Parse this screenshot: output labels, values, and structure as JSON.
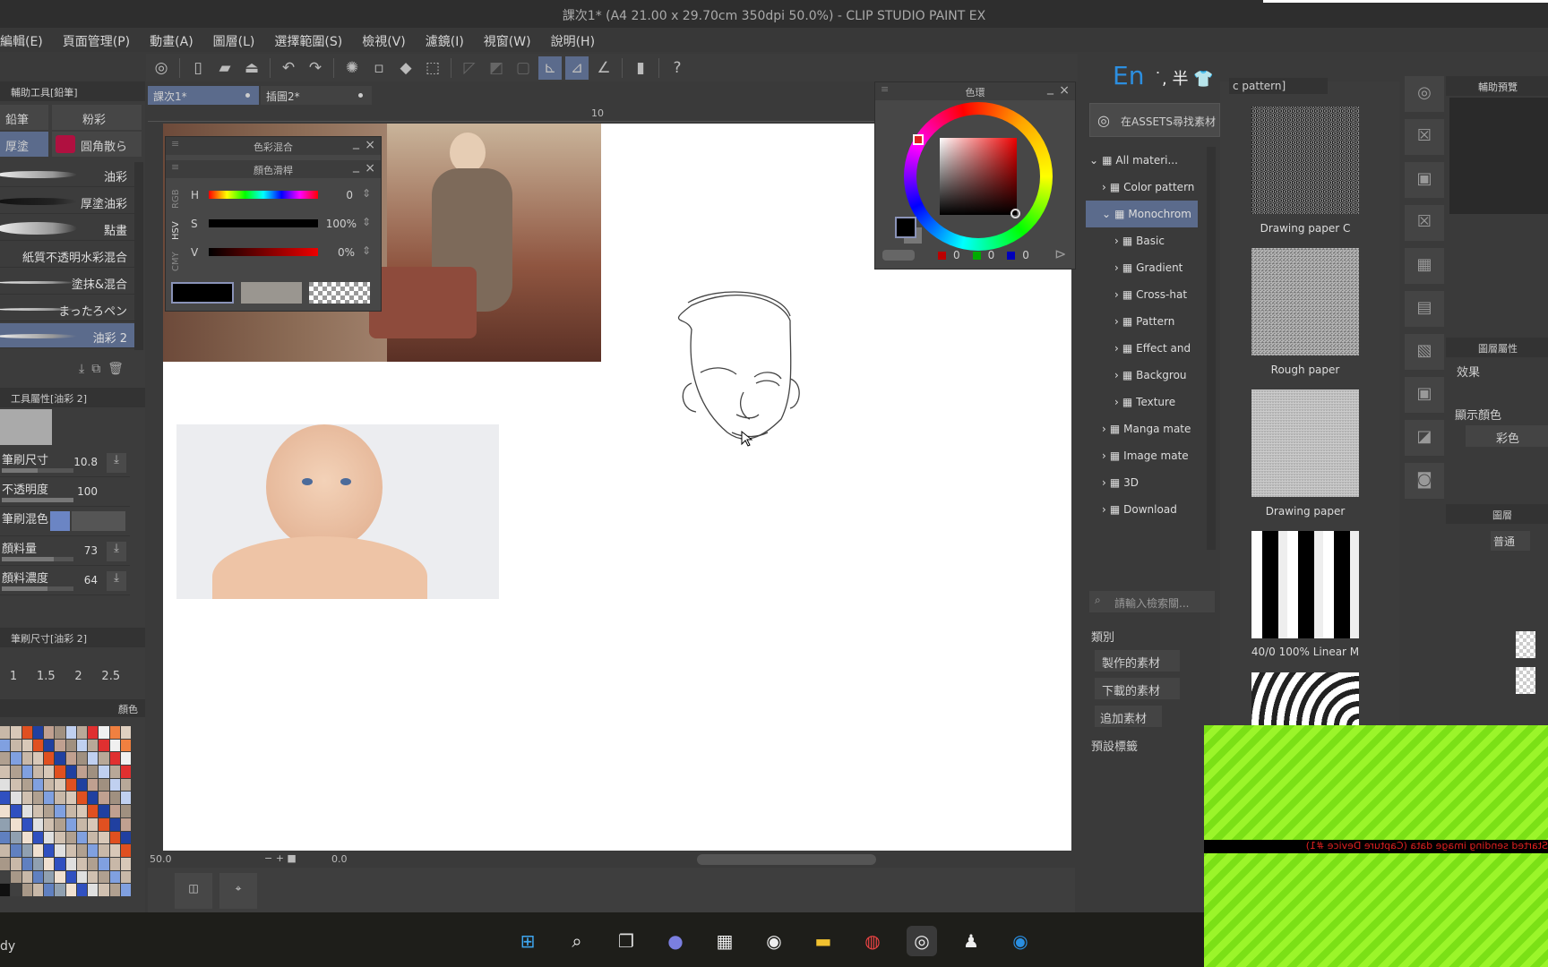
{
  "title": "課次1* (A4 21.00 x 29.70cm 350dpi 50.0%) - CLIP STUDIO PAINT EX",
  "menu": [
    "編輯(E)",
    "頁面管理(P)",
    "動畫(A)",
    "圖層(L)",
    "選擇範圍(S)",
    "檢視(V)",
    "濾鏡(I)",
    "視窗(W)",
    "說明(H)"
  ],
  "doc_tabs": [
    "課次1*",
    "插圖2*"
  ],
  "ruler_label": "10",
  "left": {
    "subtool_header": "輔助工具[鉛筆]",
    "subtabs": [
      "鉛筆",
      "粉彩",
      "厚塗",
      "圓角散ら"
    ],
    "brushes": [
      "油彩",
      "厚塗油彩",
      "點畫",
      "紙質不透明水彩混合",
      "塗抹&混合",
      "まったろペン",
      "油彩 2"
    ],
    "selected_brush": "油彩 2",
    "tool_prop_header": "工具屬性[油彩 2]",
    "props": [
      {
        "label": "筆刷尺寸",
        "value": "10.8",
        "level": 0.5
      },
      {
        "label": "不透明度",
        "value": "100",
        "level": 1.0
      },
      {
        "label": "筆刷混色",
        "value": "",
        "level": 0
      },
      {
        "label": "顏料量",
        "value": "73",
        "level": 0.73
      },
      {
        "label": "顏料濃度",
        "value": "64",
        "level": 0.64
      }
    ],
    "brush_size_header": "筆刷尺寸[油彩 2]",
    "sizes": [
      "1",
      "1.5",
      "2",
      "2.5"
    ],
    "color_set_label": "顏色"
  },
  "mix": {
    "outer_title": "色彩混合",
    "title": "顏色滑桿",
    "modes": [
      "RGB",
      "HSV",
      "CMY"
    ],
    "active_mode": "HSV",
    "sliders": [
      {
        "label": "H",
        "value": "0"
      },
      {
        "label": "S",
        "value": "100%"
      },
      {
        "label": "V",
        "value": "0%"
      }
    ],
    "main_color": "#000000",
    "sub_color": "#9a9690"
  },
  "color_wheel": {
    "title": "色環",
    "r": "0",
    "g": "0",
    "b": "0",
    "hue_color": "#ff0000"
  },
  "materials": {
    "lang": "En",
    "path_label": "c pattern]",
    "assets_button": "在ASSETS尋找素材",
    "tree": [
      {
        "label": "All materi...",
        "indent": 0,
        "open": true
      },
      {
        "label": "Color pattern",
        "indent": 1
      },
      {
        "label": "Monochrom",
        "indent": 1,
        "open": true,
        "selected": true
      },
      {
        "label": "Basic",
        "indent": 2
      },
      {
        "label": "Gradient",
        "indent": 2
      },
      {
        "label": "Cross-hat",
        "indent": 2
      },
      {
        "label": "Pattern",
        "indent": 2
      },
      {
        "label": "Effect and",
        "indent": 2
      },
      {
        "label": "Backgrou",
        "indent": 2
      },
      {
        "label": "Texture",
        "indent": 2
      },
      {
        "label": "Manga mate",
        "indent": 1
      },
      {
        "label": "Image mate",
        "indent": 1
      },
      {
        "label": "3D",
        "indent": 1
      },
      {
        "label": "Download",
        "indent": 1
      }
    ],
    "search_placeholder": "請輸入檢索關...",
    "category_label": "類別",
    "categories": [
      "製作的素材",
      "下載的素材",
      "追加素材"
    ],
    "preset_tags": "預設標籤",
    "thumbs": [
      "Drawing paper C",
      "Rough paper",
      "Drawing paper",
      "40/0 100% Linear M"
    ]
  },
  "right": {
    "nav_header": "輔助預覽",
    "layer_prop_header": "圖層屬性",
    "effect_label": "效果",
    "display_color_label": "顯示顏色",
    "display_color_value": "彩色",
    "layer_header": "圖層",
    "blend_mode": "普通"
  },
  "canvas_bar": {
    "zoom": "50.0",
    "angle": "0.0"
  },
  "status_left": "dy",
  "capture_overlay": "Started sending image data (Capture Device #1)",
  "taskbar": [
    "windows-start",
    "search",
    "task-view",
    "teams",
    "store",
    "alienware",
    "file-explorer",
    "chrome",
    "clip-studio",
    "qq",
    "app"
  ]
}
